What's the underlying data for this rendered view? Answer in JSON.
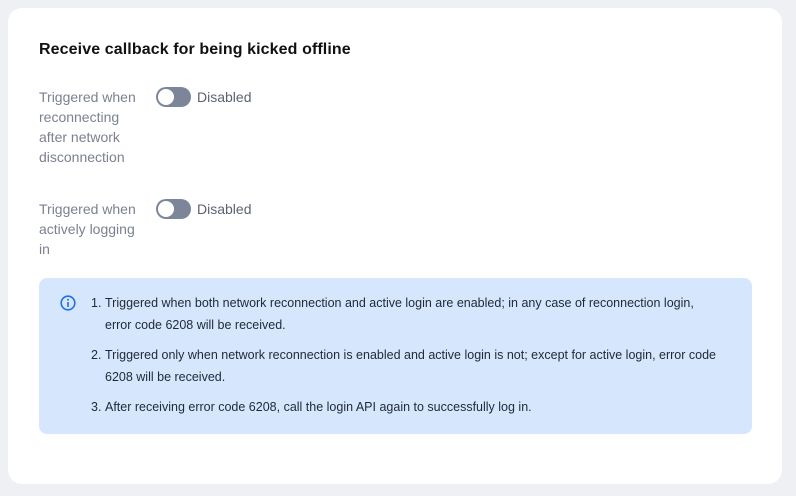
{
  "section": {
    "title": "Receive callback for being kicked offline"
  },
  "settings": [
    {
      "label": "Triggered when reconnecting after network disconnection",
      "state": "Disabled",
      "enabled": false
    },
    {
      "label": "Triggered when actively logging in",
      "state": "Disabled",
      "enabled": false
    }
  ],
  "info": {
    "icon": "info-icon",
    "accent": "#1f6fe5",
    "items": [
      {
        "num": "1.",
        "text": "Triggered when both network reconnection and active login are enabled; in any case of reconnection login, error code 6208 will be received."
      },
      {
        "num": "2.",
        "text": "Triggered only when network reconnection is enabled and active login is not; except for active login, error code 6208 will be received."
      },
      {
        "num": "3.",
        "text": "After receiving error code 6208, call the login API again to successfully log in."
      }
    ]
  },
  "colors": {
    "toggle_off": "#7c8698",
    "info_bg": "#d6e6fd",
    "card_bg": "#ffffff"
  }
}
